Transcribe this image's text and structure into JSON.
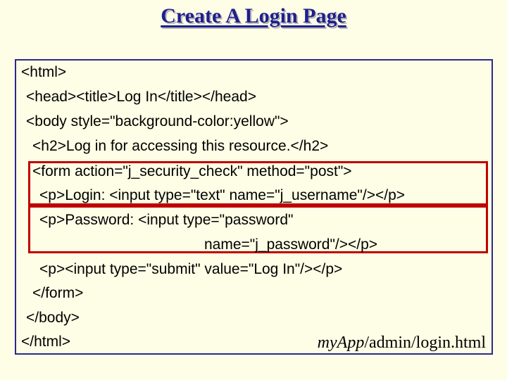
{
  "title": "Create A Login Page",
  "code": {
    "l1": "<html>",
    "l2": "<head><title>Log In</title></head>",
    "l3": "<body style=\"background-color:yellow\">",
    "l4": "<h2>Log in for accessing this resource.</h2>",
    "l5": "<form action=\"j_security_check\" method=\"post\">",
    "l6": "<p>Login: <input type=\"text\" name=\"j_username\"/></p>",
    "l7": "<p>Password: <input type=\"password\"",
    "l8": "name=\"j_password\"/></p>",
    "l9": "<p><input type=\"submit\" value=\"Log In\"/></p>",
    "l10": "</form>",
    "l11": "</body>",
    "l12": "</html>"
  },
  "file_path": {
    "app": "myApp",
    "rest": "/admin/login.html"
  }
}
